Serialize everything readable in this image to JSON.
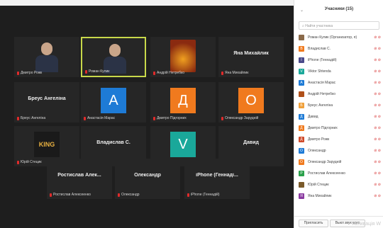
{
  "tiles": [
    {
      "id": "t1",
      "name": "Дмитро Рожк",
      "type": "photo",
      "color": "#6b5b4b"
    },
    {
      "id": "t2",
      "name": "Роман Кулик",
      "type": "photo",
      "color": "#2a3a2a",
      "active": true
    },
    {
      "id": "t3",
      "name": "Андрій Нетребко",
      "type": "image",
      "color": "#8a2a10"
    },
    {
      "id": "t4",
      "name": "Яна Михайлик",
      "type": "text",
      "center": "Яна Михайлик"
    },
    {
      "id": "t5",
      "name": "Бреус Ангеліна",
      "type": "text",
      "center": "Бреус Ангеліна"
    },
    {
      "id": "t6",
      "name": "Анастасія Марас",
      "type": "letter",
      "letter": "А",
      "color": "#1e7bd6"
    },
    {
      "id": "t7",
      "name": "Дмитро Підгорних",
      "type": "letter",
      "letter": "Д",
      "color": "#f07a1e"
    },
    {
      "id": "t8",
      "name": "Олександр Зарудній",
      "type": "letter",
      "letter": "О",
      "color": "#f07a1e"
    },
    {
      "id": "t9",
      "name": "Юрій Стецик",
      "type": "king",
      "center": "KING"
    },
    {
      "id": "t10",
      "name": "Владислав С.",
      "type": "text",
      "center": "Владислав С."
    },
    {
      "id": "t11",
      "name": "Viktor Shtenda",
      "type": "letter",
      "letter": "V",
      "color": "#1aa89a"
    },
    {
      "id": "t12",
      "name": "Давид",
      "type": "text",
      "center": "Давид"
    },
    {
      "id": "t13",
      "name": "Ростислав Алексеенко",
      "type": "text",
      "center": "Ростислав Алек..."
    },
    {
      "id": "t14",
      "name": "Олександр",
      "type": "text",
      "center": "Олександр"
    },
    {
      "id": "t15",
      "name": "iPhone (Геннадій)",
      "type": "text",
      "center": "iPhone (Геннаді..."
    }
  ],
  "panel": {
    "title": "Учасники (15)",
    "search_placeholder": "Найти участника",
    "invite": "Пригласить",
    "mute_all": "Выкл звук всех",
    "watermark": "Активація W",
    "participants": [
      {
        "name": "Роман Кулик (Организатор, я)",
        "letter": "",
        "color": "#8a6a4a"
      },
      {
        "name": "Владислав С.",
        "letter": "В",
        "color": "#f07a1e"
      },
      {
        "name": "iPhone (Геннадій)",
        "letter": "I",
        "color": "#4a4a8a"
      },
      {
        "name": "Viktor Shtenda",
        "letter": "V",
        "color": "#1aa89a"
      },
      {
        "name": "Анастасія Марас",
        "letter": "А",
        "color": "#1e7bd6"
      },
      {
        "name": "Андрій Нетребко",
        "letter": "",
        "color": "#b0501a"
      },
      {
        "name": "Бреус Ангеліна",
        "letter": "Б",
        "color": "#f0a03a"
      },
      {
        "name": "Давид",
        "letter": "Д",
        "color": "#1e7bd6"
      },
      {
        "name": "Дмитро Підгорних",
        "letter": "Д",
        "color": "#f07a1e"
      },
      {
        "name": "Дмитро Рожк",
        "letter": "Д",
        "color": "#d04a2a"
      },
      {
        "name": "Олександр",
        "letter": "О",
        "color": "#1e7bd6"
      },
      {
        "name": "Олександр Зарудній",
        "letter": "О",
        "color": "#f07a1e"
      },
      {
        "name": "Ростислав Алексеенко",
        "letter": "Р",
        "color": "#2aa04a"
      },
      {
        "name": "Юрій Стецик",
        "letter": "",
        "color": "#7a5a2a"
      },
      {
        "name": "Яна Михайлик",
        "letter": "Я",
        "color": "#8a3aa0"
      }
    ]
  }
}
